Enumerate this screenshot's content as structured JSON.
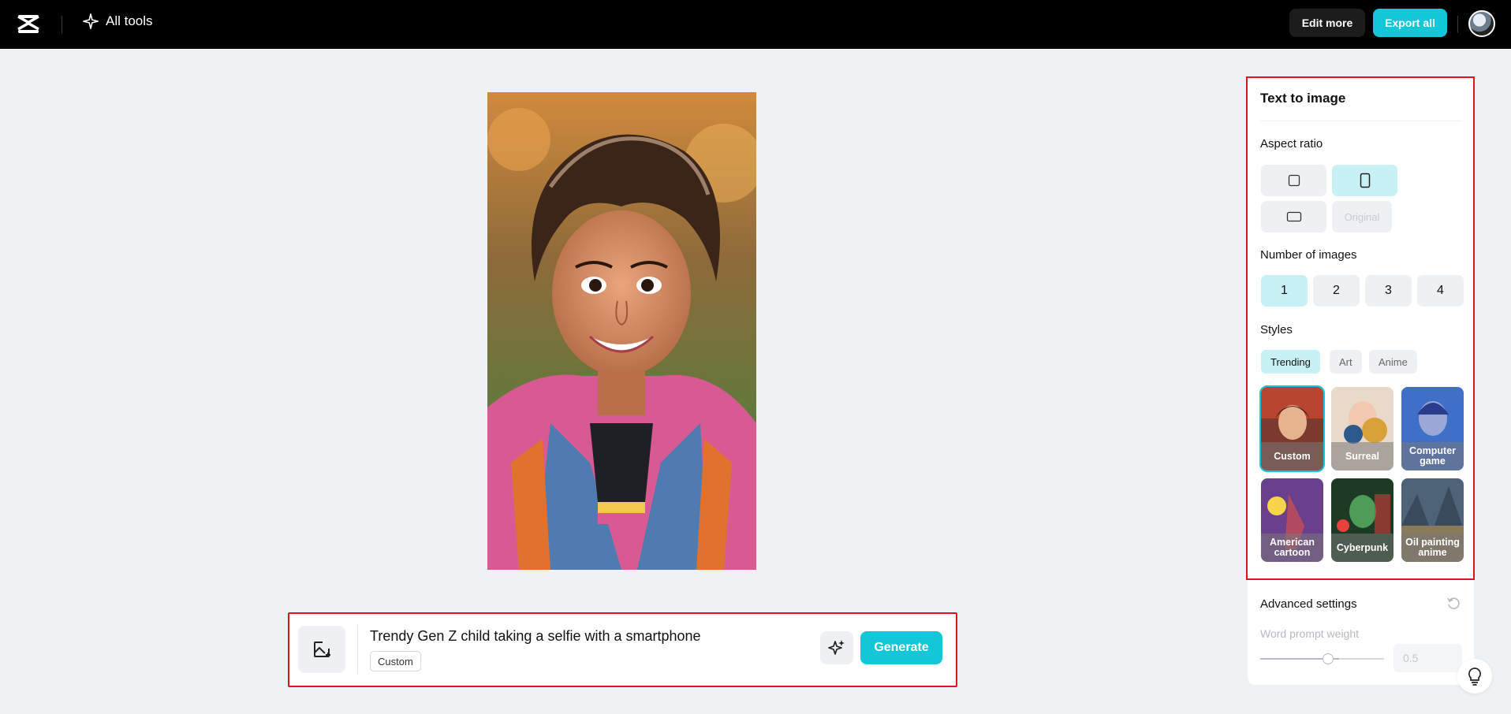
{
  "topbar": {
    "logo_icon": "capcut-logo-icon",
    "all_tools_label": "All tools",
    "edit_more_label": "Edit more",
    "export_all_label": "Export all",
    "accent_color": "#13c6d8"
  },
  "prompt": {
    "text": "Trendy Gen Z child taking a selfie with a smartphone",
    "style_chip": "Custom",
    "generate_label": "Generate"
  },
  "panel": {
    "title": "Text to image",
    "aspect_ratio_label": "Aspect ratio",
    "aspect_ratios": [
      {
        "icon": "square-ratio-icon",
        "active": false
      },
      {
        "icon": "portrait-ratio-icon",
        "active": true
      },
      {
        "icon": "landscape-ratio-icon",
        "active": false
      },
      {
        "label": "Original",
        "active": false,
        "disabled": true
      }
    ],
    "number_label": "Number of images",
    "numbers": [
      "1",
      "2",
      "3",
      "4"
    ],
    "selected_number": "1",
    "styles_label": "Styles",
    "style_tabs": [
      "Trending",
      "Art",
      "Anime"
    ],
    "selected_tab": "Trending",
    "style_cards": [
      {
        "label": "Custom",
        "selected": true
      },
      {
        "label": "Surreal",
        "selected": false
      },
      {
        "label": "Computer game",
        "selected": false
      },
      {
        "label": "American cartoon",
        "selected": false
      },
      {
        "label": "Cyberpunk",
        "selected": false
      },
      {
        "label": "Oil painting anime",
        "selected": false
      }
    ],
    "advanced_label": "Advanced settings",
    "word_prompt_weight_label": "Word prompt weight",
    "word_prompt_weight_value": "0.5"
  }
}
